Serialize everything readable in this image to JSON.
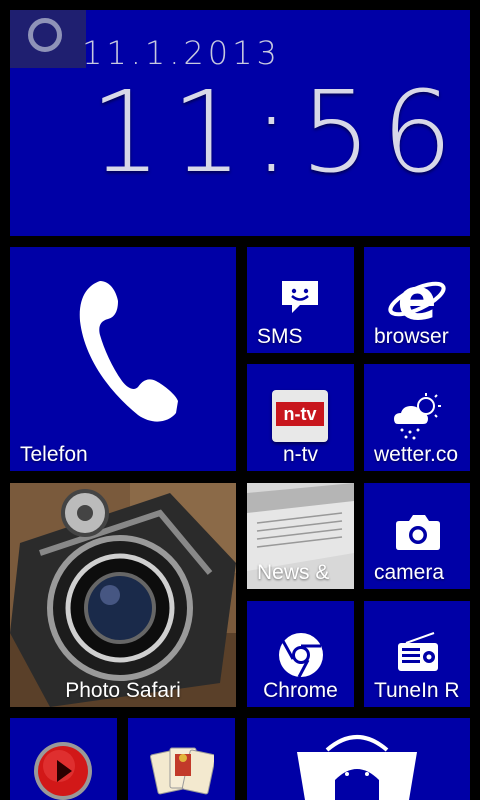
{
  "lockscreen": {
    "date": "11.1.2013",
    "time": "11:56"
  },
  "tiles": {
    "telefon": "Telefon",
    "sms": "SMS",
    "browser": "browser",
    "ntv": "n-tv",
    "ntv_logo": "n-tv",
    "wetter": "wetter.co",
    "news": "News &",
    "camera": "camera",
    "photo_safari": "Photo Safari",
    "chrome": "Chrome",
    "tunein": "TuneIn R"
  },
  "colors": {
    "tile_background": "#0000a6",
    "screen_background": "#000000"
  },
  "icons": [
    "circle-icon",
    "phone-icon",
    "sms-icon",
    "ie-icon",
    "ntv-logo",
    "weather-icon",
    "camera-icon",
    "chrome-icon",
    "radio-icon",
    "record-icon",
    "cards-icon",
    "store-bag-icon"
  ]
}
